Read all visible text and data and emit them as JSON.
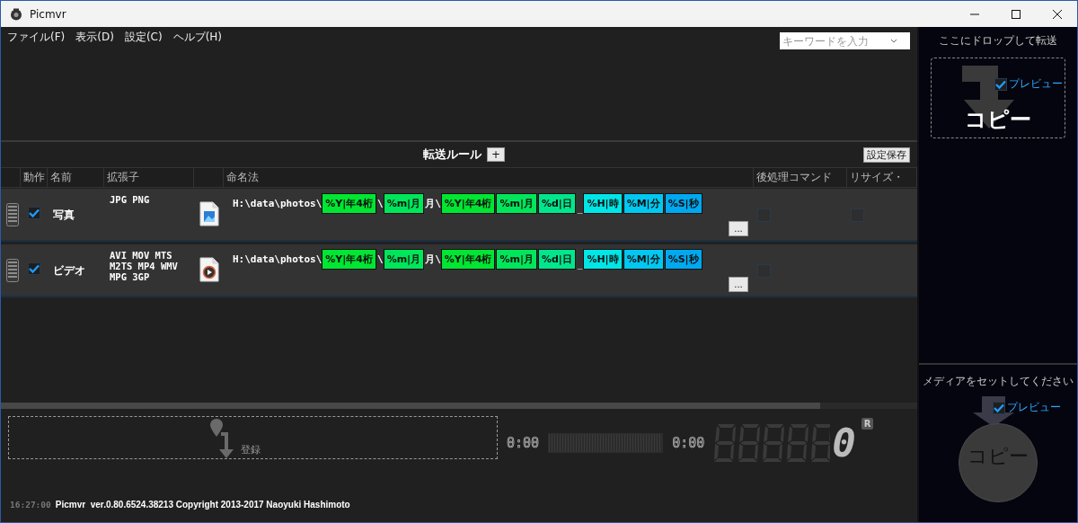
{
  "window": {
    "title": "Picmvr"
  },
  "menu": [
    "ファイル(F)",
    "表示(D)",
    "設定(C)",
    "ヘルプ(H)"
  ],
  "search": {
    "placeholder": "キーワードを入力"
  },
  "rules_toolbar": {
    "title": "転送ルール",
    "add_button": "+",
    "save_button": "設定保存"
  },
  "table": {
    "columns": [
      "動作",
      "名前",
      "拡張子",
      "命名法",
      "後処理コマンド",
      "リサイズ・"
    ],
    "rows": [
      {
        "enabled": true,
        "name": "写真",
        "extensions": "JPG PNG",
        "kind": "image",
        "naming": [
          {
            "kind": "text",
            "text": "H:\\data\\photos\\"
          },
          {
            "kind": "token",
            "text": "%Y|年4桁",
            "color": "#00e632"
          },
          {
            "kind": "text",
            "text": "\\"
          },
          {
            "kind": "token",
            "text": "%m|月",
            "color": "#00e65a"
          },
          {
            "kind": "text",
            "text": "月\\"
          },
          {
            "kind": "token",
            "text": "%Y|年4桁",
            "color": "#00e632"
          },
          {
            "kind": "token",
            "text": "%m|月",
            "color": "#00e65a"
          },
          {
            "kind": "token",
            "text": "%d|日",
            "color": "#00e68c"
          },
          {
            "kind": "underscore",
            "text": "_"
          },
          {
            "kind": "token",
            "text": "%H|時",
            "color": "#00e6e6"
          },
          {
            "kind": "token",
            "text": "%M|分",
            "color": "#00c8f0"
          },
          {
            "kind": "token",
            "text": "%S|秒",
            "color": "#00a8f0"
          }
        ],
        "more_button": "...",
        "post_command": false,
        "resize": false
      },
      {
        "enabled": true,
        "name": "ビデオ",
        "extensions": "AVI MOV MTS M2TS MP4 WMV MPG 3GP",
        "kind": "video",
        "naming": [
          {
            "kind": "text",
            "text": "H:\\data\\photos\\"
          },
          {
            "kind": "token",
            "text": "%Y|年4桁",
            "color": "#00e632"
          },
          {
            "kind": "text",
            "text": "\\"
          },
          {
            "kind": "token",
            "text": "%m|月",
            "color": "#00e65a"
          },
          {
            "kind": "text",
            "text": "月\\"
          },
          {
            "kind": "token",
            "text": "%Y|年4桁",
            "color": "#00e632"
          },
          {
            "kind": "token",
            "text": "%m|月",
            "color": "#00e65a"
          },
          {
            "kind": "token",
            "text": "%d|日",
            "color": "#00e68c"
          },
          {
            "kind": "underscore",
            "text": "_"
          },
          {
            "kind": "token",
            "text": "%H|時",
            "color": "#00e6e6"
          },
          {
            "kind": "token",
            "text": "%M|分",
            "color": "#00c8f0"
          },
          {
            "kind": "token",
            "text": "%S|秒",
            "color": "#00a8f0"
          }
        ],
        "more_button": "...",
        "post_command": false
      }
    ]
  },
  "register_zone": {
    "label": "登録"
  },
  "player": {
    "start_time": "0:00",
    "end_time": "0:00",
    "counter": "0",
    "reset_badge": "R"
  },
  "status_bar": {
    "time": "16:27:00",
    "text": "Picmvr  ver.0.80.6524.38213 Copyright 2013-2017 Naoyuki Hashimoto"
  },
  "side_panel": {
    "drop_title": "ここにドロップして転送",
    "drop_preview": {
      "label": "プレビュー",
      "checked": true
    },
    "drop_copy": "コピー",
    "media_title": "メディアをセットしてください",
    "media_preview": {
      "label": "プレビュー",
      "checked": true
    },
    "media_copy": "コピー"
  }
}
